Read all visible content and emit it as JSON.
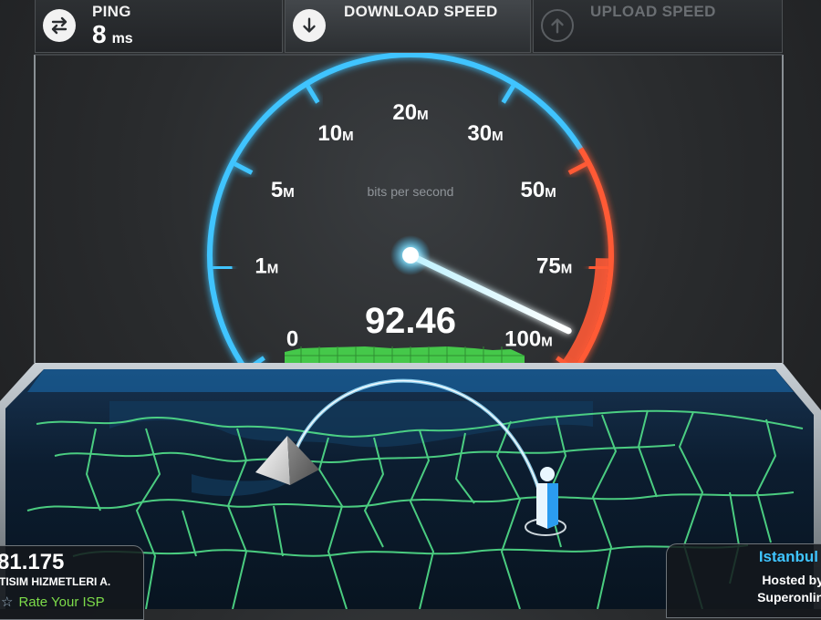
{
  "tabs": {
    "ping": {
      "label": "PING",
      "value": "8",
      "unit": "ms",
      "icon": "exchange-arrows-icon"
    },
    "download": {
      "label": "DOWNLOAD SPEED",
      "icon": "arrow-down-circle-icon",
      "active": true
    },
    "upload": {
      "label": "UPLOAD SPEED",
      "icon": "arrow-up-circle-icon",
      "active": false
    }
  },
  "gauge": {
    "unit_label": "bits per second",
    "current_value": "92.46",
    "needle_value": 92.46,
    "ticks": [
      "0",
      "1M",
      "5M",
      "10M",
      "20M",
      "30M",
      "50M",
      "75M",
      "100M"
    ],
    "colors": {
      "blue": "#3fc4ff",
      "red": "#ff5a36",
      "green": "#4bd84b"
    }
  },
  "client": {
    "ip": "81.175",
    "isp": "TISIM HIZMETLERI A.",
    "rate_label": "Rate Your ISP"
  },
  "server": {
    "city": "Istanbul",
    "hosted_label": "Hosted by",
    "host": "Superonline"
  },
  "colors": {
    "map_line": "#52e08a",
    "arc": "#9fe3ff",
    "board": "#0b1a2a"
  }
}
